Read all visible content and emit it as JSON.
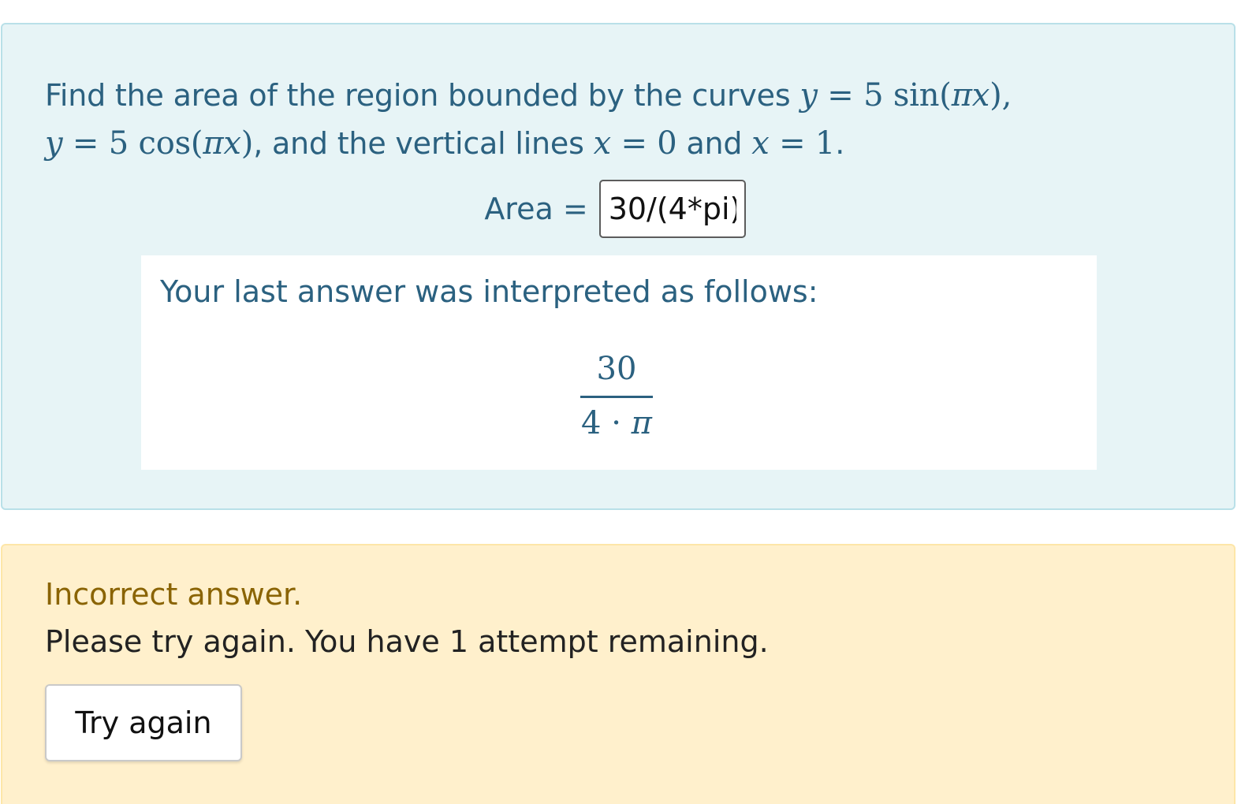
{
  "question": {
    "line1_text": "Find the area of the region bounded by the curves ",
    "line1_math_y": "y",
    "line1_math_eq": " = 5 sin(",
    "line1_math_pi": "πx",
    "line1_math_close": "),",
    "line2_math_y": "y",
    "line2_math_eq": " = 5 cos(",
    "line2_math_pi": "πx",
    "line2_math_close": ")",
    "line2_text_a": ", and the vertical lines ",
    "line2_math_x1": "x",
    "line2_math_eq1": " = 0",
    "line2_text_b": " and ",
    "line2_math_x2": "x",
    "line2_math_eq2": " = 1",
    "line2_text_end": "."
  },
  "answer": {
    "label": "Area =",
    "value": "30/(4*pi)"
  },
  "interpretation": {
    "heading": "Your last answer was interpreted as follows:",
    "numerator": "30",
    "denominator_num": "4 · ",
    "denominator_pi": "π"
  },
  "result": {
    "status": "Incorrect answer.",
    "message": "Please try again. You have 1 attempt remaining.",
    "button_label": "Try again"
  },
  "colors": {
    "question_bg": "#e7f4f6",
    "question_text": "#2b6180",
    "result_bg": "#fff0cc",
    "incorrect_text": "#8a6404"
  }
}
